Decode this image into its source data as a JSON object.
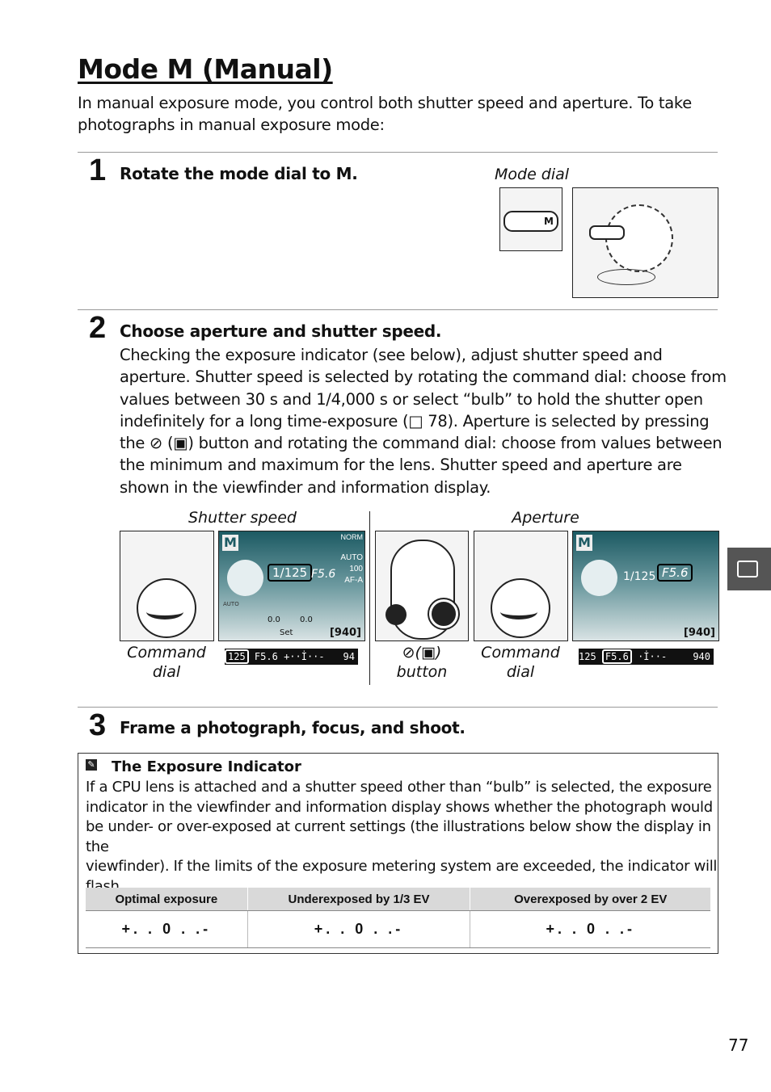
{
  "title": "Mode M (Manual)",
  "intro": [
    "In manual exposure mode, you control both shutter speed and aperture.  To take",
    "photographs in manual exposure mode:"
  ],
  "steps": [
    {
      "number": "1",
      "heading": "Rotate the mode dial to M.",
      "figure_caption": "Mode dial"
    },
    {
      "number": "2",
      "heading": "Choose aperture and shutter speed.",
      "body": [
        "Checking the exposure indicator (see below), adjust shutter speed and",
        "aperture.  Shutter speed is selected by rotating the command dial: choose from",
        "values between 30 s and 1/4,000 s or select “bulb” to hold the shutter open",
        "indefinitely for a long time-exposure (□ 78).  Aperture is selected by pressing",
        "the ⊘ (▣) button and rotating the command dial: choose from values between",
        "the minimum and maximum for the lens.  Shutter speed and aperture are",
        "shown in the viewfinder and information display."
      ],
      "figures": {
        "shutter_label": "Shutter speed",
        "aperture_label": "Aperture",
        "command_dial_1": "Command dial",
        "command_dial_2": "Command dial",
        "button_caption": "⊘(▣) button",
        "lcd": {
          "mode": "M",
          "shutter": "1/125",
          "aperture": "F5.6",
          "quality": "NORM",
          "wb": "AUTO",
          "iso": "100",
          "af": "AF-A",
          "flash_comp": "0.0",
          "exp_comp": "0.0",
          "set": "Set",
          "count": "[940]",
          "auto": "AUTO"
        },
        "viewfinder_1": {
          "shutter": "125",
          "aperture": "F5.6",
          "indicator": "+··İ··-",
          "count": "94"
        },
        "viewfinder_2": {
          "shutter": "125",
          "aperture": "F5.6",
          "indicator": "·İ··-",
          "count": "940"
        }
      }
    },
    {
      "number": "3",
      "heading": "Frame a photograph, focus, and shoot."
    }
  ],
  "note": {
    "icon": "pencil-icon",
    "title": "The Exposure Indicator",
    "body": [
      "If a CPU lens is attached and a shutter speed other than “bulb” is selected, the exposure",
      "indicator in the viewfinder and information display shows whether the photograph would",
      "be under- or over-exposed at current settings (the illustrations below show the display in the",
      "viewfinder).  If the limits of the exposure metering system are exceeded, the indicator will",
      "flash."
    ],
    "table": {
      "headers": [
        "Optimal exposure",
        "Underexposed by 1/3 EV",
        "Overexposed by over 2 EV"
      ],
      "row": [
        "+. . 0 . .-",
        "+. . 0 . .-",
        "+. . 0 . .-"
      ]
    }
  },
  "side_tab_icon": "camera-mode-icon",
  "page_number": "77"
}
